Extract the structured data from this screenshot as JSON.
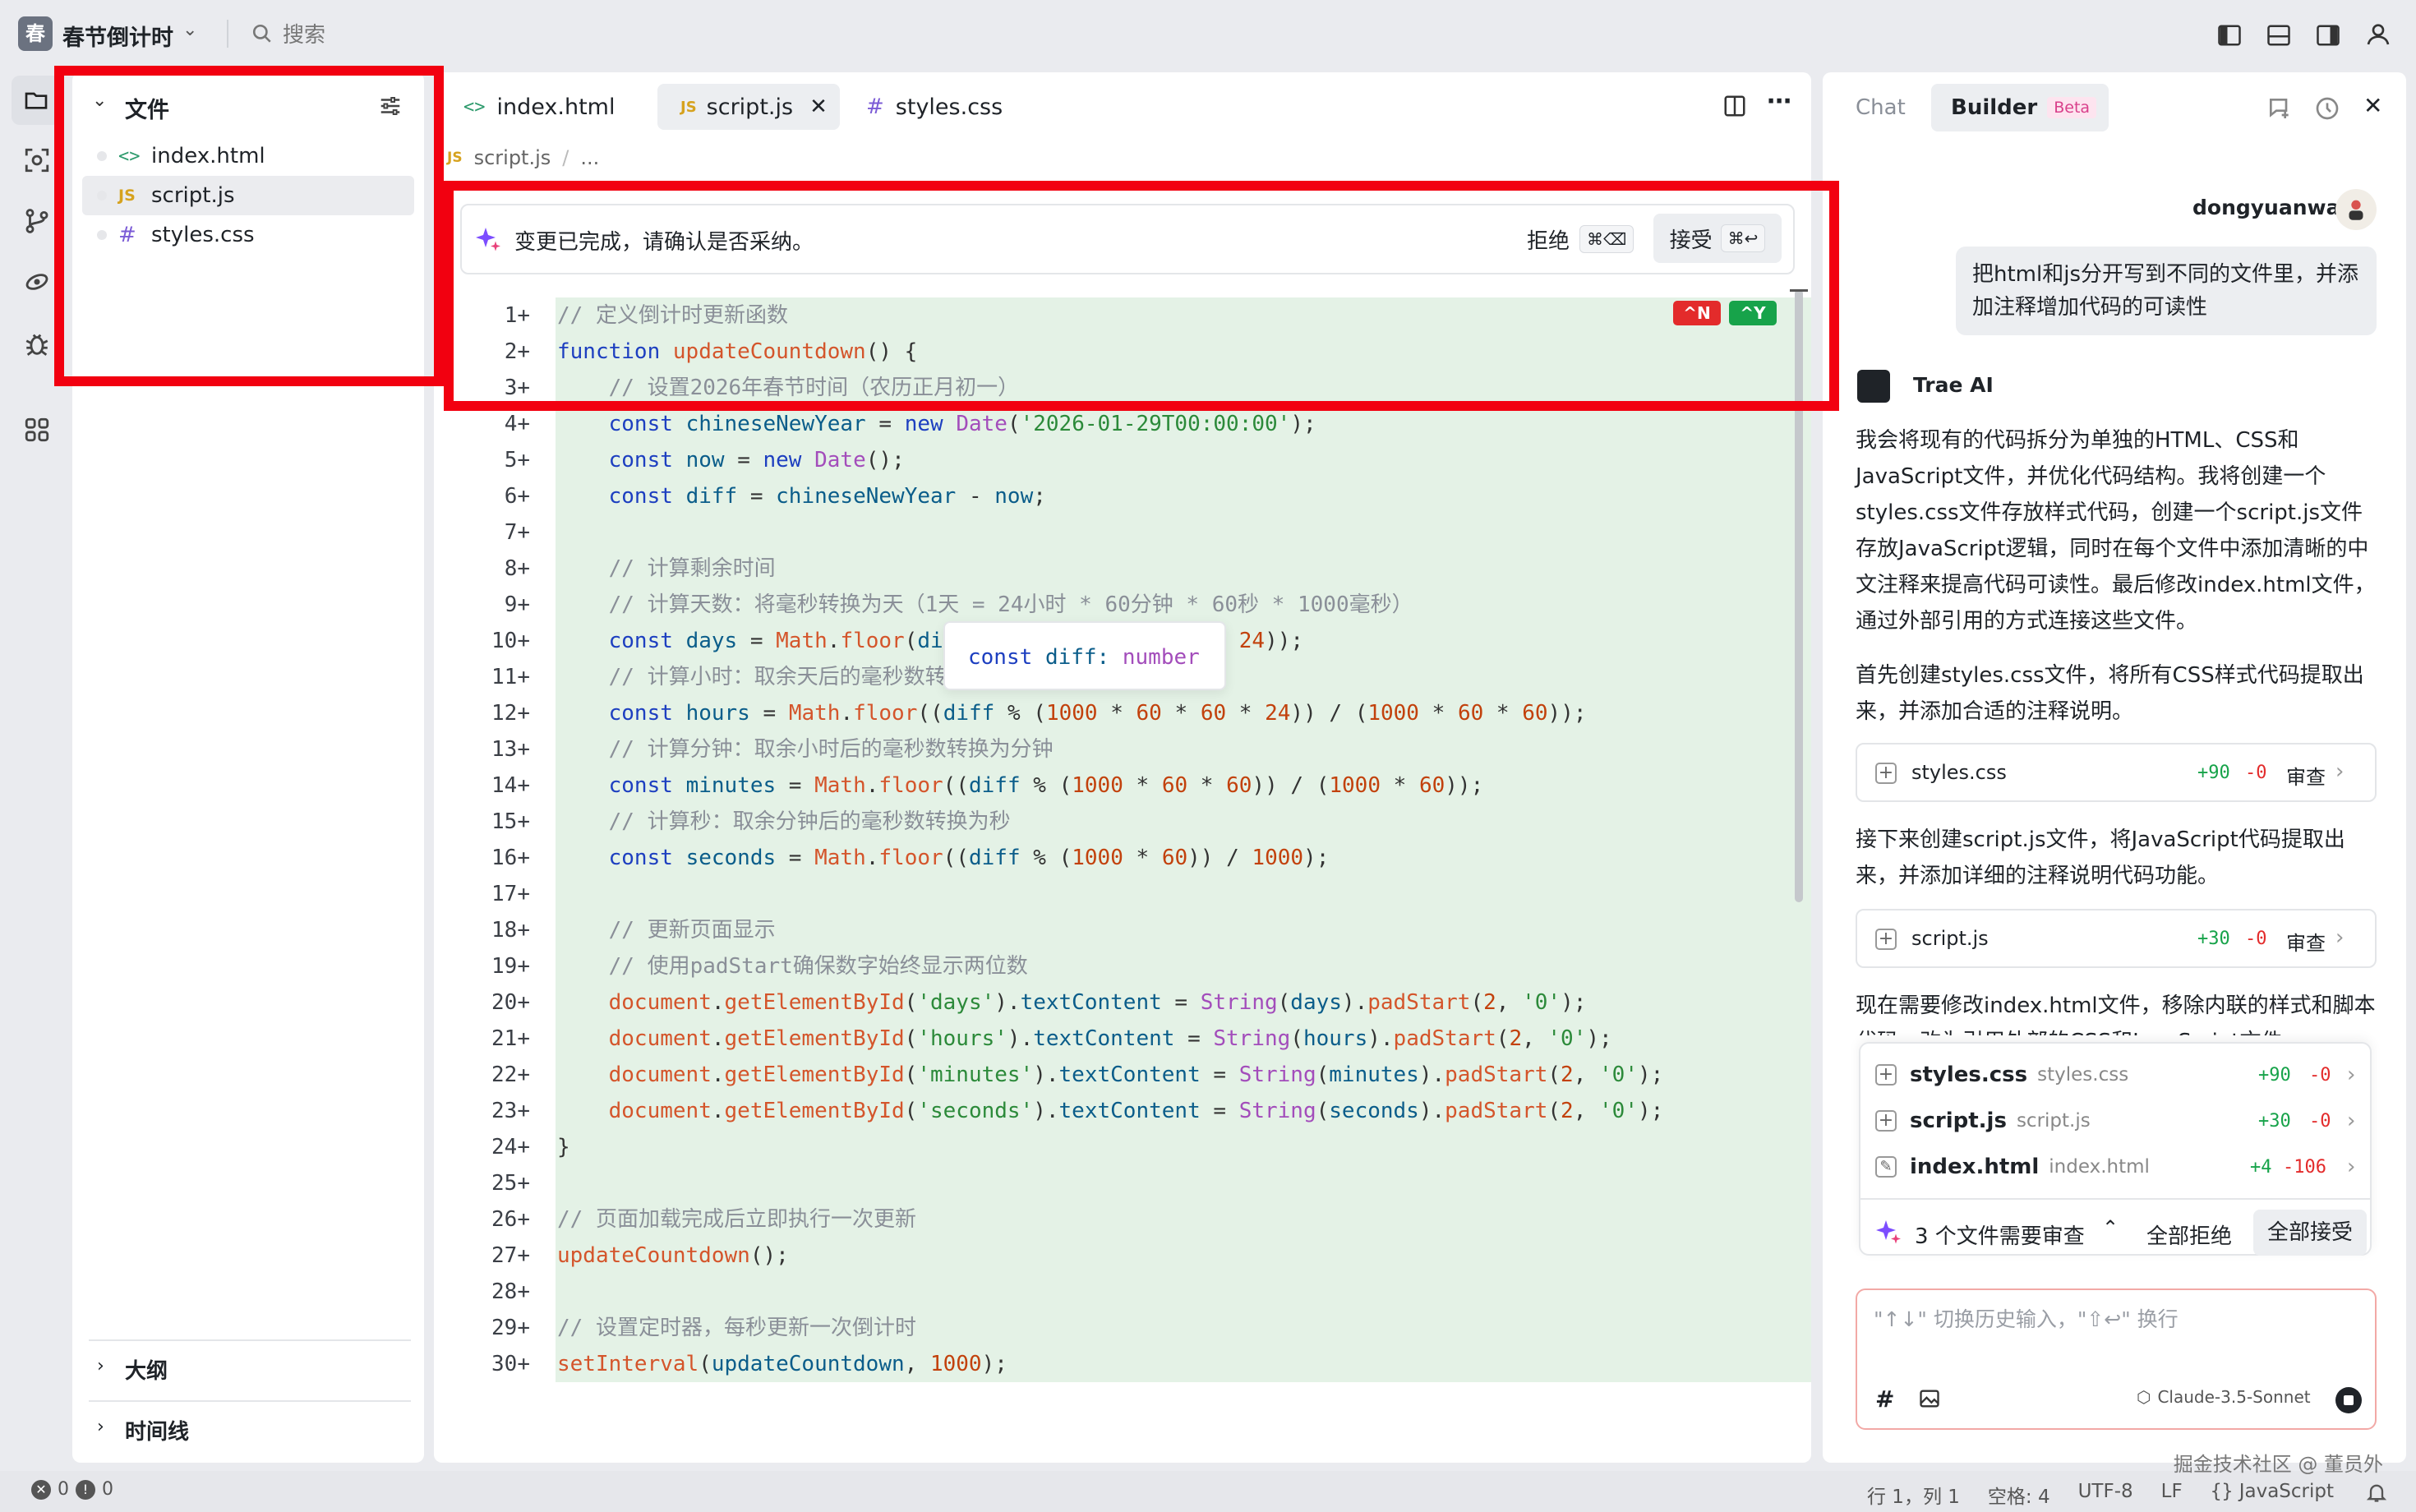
{
  "app": {
    "logo": "春",
    "title": "春节倒计时",
    "search": "搜索"
  },
  "explorer": {
    "title": "文件",
    "files": [
      {
        "name": "index.html",
        "icon": "<>"
      },
      {
        "name": "script.js",
        "icon": "JS"
      },
      {
        "name": "styles.css",
        "icon": "#"
      }
    ],
    "outline": "大纲",
    "timeline": "时间线"
  },
  "tabs": [
    {
      "label": "index.html",
      "icon": "<>"
    },
    {
      "label": "script.js",
      "icon": "JS"
    },
    {
      "label": "styles.css",
      "icon": "#"
    }
  ],
  "breadcrumb": {
    "icon": "JS",
    "file": "script.js",
    "sep": "/",
    "more": "..."
  },
  "review_bar": {
    "message": "变更已完成，请确认是否采纳。",
    "reject": "拒绝",
    "reject_kbd": "⌘⌫",
    "accept": "接受",
    "accept_kbd": "⌘↩"
  },
  "diff_badges": {
    "reject": "^N",
    "accept": "^Y"
  },
  "hover_tooltip": {
    "kw": "const",
    "name": "diff:",
    "type": "number"
  },
  "code_lines": [
    "// 定义倒计时更新函数",
    "function updateCountdown() {",
    "    // 设置2026年春节时间（农历正月初一）",
    "    const chineseNewYear = new Date('2026-01-29T00:00:00');",
    "    const now = new Date();",
    "    const diff = chineseNewYear - now;",
    "",
    "    // 计算剩余时间",
    "    // 计算天数：将毫秒转换为天（1天 = 24小时 * 60分钟 * 60秒 * 1000毫秒）",
    "    const days = Math.floor(diff / (1000 * 60 * 60 * 24));",
    "    // 计算小时：取余天后的毫秒数转换为小时",
    "    const hours = Math.floor((diff % (1000 * 60 * 60 * 24)) / (1000 * 60 * 60));",
    "    // 计算分钟：取余小时后的毫秒数转换为分钟",
    "    const minutes = Math.floor((diff % (1000 * 60 * 60)) / (1000 * 60));",
    "    // 计算秒：取余分钟后的毫秒数转换为秒",
    "    const seconds = Math.floor((diff % (1000 * 60)) / 1000);",
    "",
    "    // 更新页面显示",
    "    // 使用padStart确保数字始终显示两位数",
    "    document.getElementById('days').textContent = String(days).padStart(2, '0');",
    "    document.getElementById('hours').textContent = String(hours).padStart(2, '0');",
    "    document.getElementById('minutes').textContent = String(minutes).padStart(2, '0');",
    "    document.getElementById('seconds').textContent = String(seconds).padStart(2, '0');",
    "}",
    "",
    "// 页面加载完成后立即执行一次更新",
    "updateCountdown();",
    "",
    "// 设置定时器，每秒更新一次倒计时",
    "setInterval(updateCountdown, 1000);"
  ],
  "chat": {
    "tab_chat": "Chat",
    "tab_builder": "Builder",
    "beta": "Beta",
    "user_name": "dongyuanwai",
    "user_message": "把html和js分开写到不同的文件里，并添加注释增加代码的可读性",
    "ai_name": "Trae AI",
    "ai_para1": "我会将现有的代码拆分为单独的HTML、CSS和JavaScript文件，并优化代码结构。我将创建一个styles.css文件存放样式代码，创建一个script.js文件存放JavaScript逻辑，同时在每个文件中添加清晰的中文注释来提高代码可读性。最后修改index.html文件，通过外部引用的方式连接这些文件。",
    "ai_para2": "首先创建styles.css文件，将所有CSS样式代码提取出来，并添加合适的注释说明。",
    "card1": {
      "file": "styles.css",
      "add": "+90",
      "del": "-0",
      "review": "审查"
    },
    "ai_para3": "接下来创建script.js文件，将JavaScript代码提取出来，并添加详细的注释说明代码功能。",
    "card2": {
      "file": "script.js",
      "add": "+30",
      "del": "-0",
      "review": "审查"
    },
    "ai_para4": "现在需要修改index.html文件，移除内联的样式和脚本代码，改为引用外部的CSS和JavaScript文件。",
    "review_files": [
      {
        "name": "styles.css",
        "path": "styles.css",
        "add": "+90",
        "del": "-0"
      },
      {
        "name": "script.js",
        "path": "script.js",
        "add": "+30",
        "del": "-0"
      },
      {
        "name": "index.html",
        "path": "index.html",
        "add": "+4",
        "del": "-106"
      }
    ],
    "review_summary": "3 个文件需要审查",
    "reject_all": "全部拒绝",
    "accept_all": "全部接受",
    "input_placeholder": "\"↑↓\" 切换历史输入，\"⇧↩\" 换行",
    "model": "Claude-3.5-Sonnet"
  },
  "status": {
    "errors": "0",
    "warnings": "0",
    "position": "行 1，列 1",
    "spaces": "空格: 4",
    "encoding": "UTF-8",
    "eol": "LF",
    "language": "JavaScript",
    "watermark": "掘金技术社区 @ 董员外"
  },
  "colors": {
    "added_bg": "#e4f2e6",
    "accent_red": "#f20010",
    "accent_green": "#17a34a"
  }
}
